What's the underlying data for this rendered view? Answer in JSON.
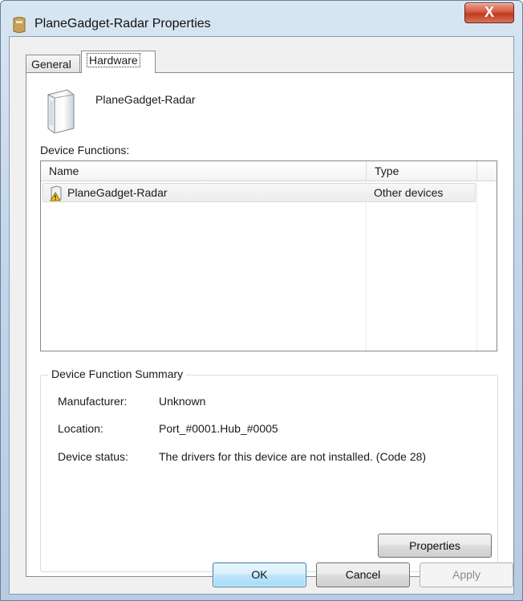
{
  "window": {
    "title": "PlaneGadget-Radar Properties",
    "close_label": "X"
  },
  "tabs": [
    {
      "label": "General",
      "selected": false
    },
    {
      "label": "Hardware",
      "selected": true
    }
  ],
  "device": {
    "name": "PlaneGadget-Radar",
    "icon": "computer-tower-icon"
  },
  "functions": {
    "label": "Device Functions:",
    "columns": [
      "Name",
      "Type"
    ],
    "rows": [
      {
        "name": "PlaneGadget-Radar",
        "type": "Other devices",
        "icon": "device-warning-icon"
      }
    ]
  },
  "summary": {
    "legend": "Device Function Summary",
    "manufacturer_label": "Manufacturer:",
    "manufacturer_value": "Unknown",
    "location_label": "Location:",
    "location_value": "Port_#0001.Hub_#0005",
    "status_label": "Device status:",
    "status_value": "The drivers for this device are not installed. (Code 28)",
    "properties_button": "Properties"
  },
  "footer": {
    "ok": "OK",
    "cancel": "Cancel",
    "apply": "Apply"
  },
  "colors": {
    "frame": "#c4d6ea",
    "close_button": "#c2391c",
    "ok_border": "#3c7fb1"
  }
}
